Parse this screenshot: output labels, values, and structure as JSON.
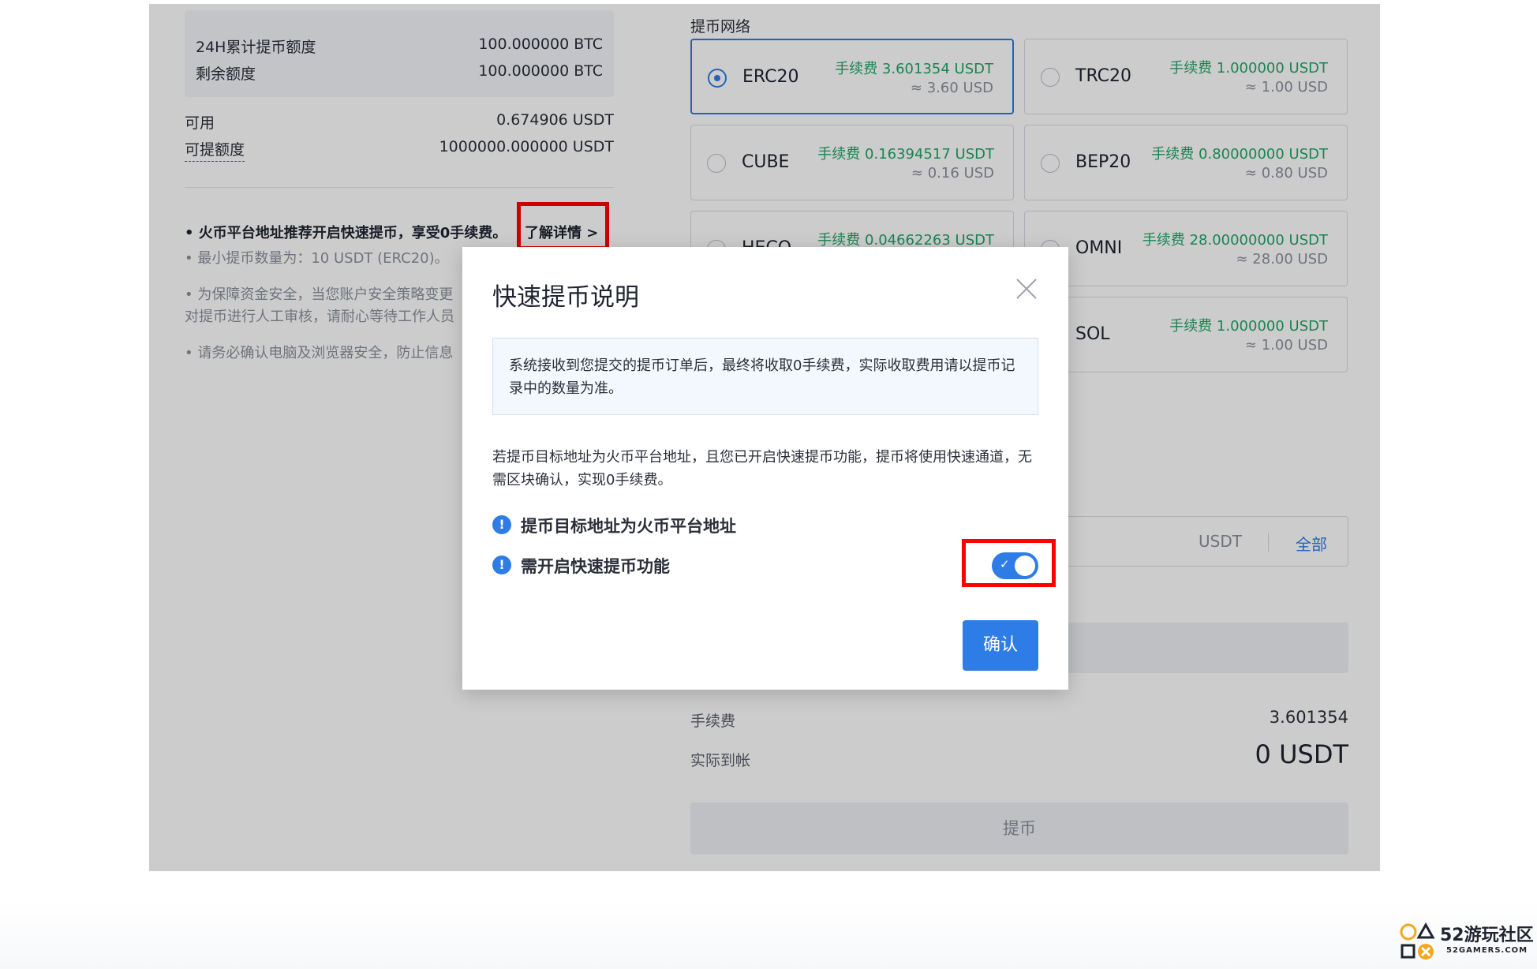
{
  "left": {
    "quota_24h_label": "24H累计提币额度",
    "quota_24h_value": "100.000000 BTC",
    "remaining_label": "剩余额度",
    "remaining_value": "100.000000 BTC",
    "available_label": "可用",
    "available_value": "0.674906 USDT",
    "withdrawable_label": "可提额度",
    "withdrawable_value": "1000000.000000 USDT",
    "notice_fast": "• 火币平台地址推荐开启快速提币，享受0手续费。",
    "learn_more": "了解详情 >",
    "notice_min": "• 最小提币数量为：10 USDT (ERC20)。",
    "notice_security_1": "• 为保障资金安全，当您账户安全策略变更",
    "notice_security_2": "对提币进行人工审核，请耐心等待工作人员",
    "notice_device": "• 请务必确认电脑及浏览器安全，防止信息"
  },
  "networks": {
    "title": "提币网络",
    "items": [
      {
        "name": "ERC20",
        "fee": "手续费 3.601354 USDT",
        "approx": "≈ 3.60 USD",
        "selected": true
      },
      {
        "name": "TRC20",
        "fee": "手续费 1.000000 USDT",
        "approx": "≈ 1.00 USD",
        "selected": false
      },
      {
        "name": "CUBE",
        "fee": "手续费 0.16394517 USDT",
        "approx": "≈ 0.16 USD",
        "selected": false
      },
      {
        "name": "BEP20",
        "fee": "手续费 0.80000000 USDT",
        "approx": "≈ 0.80 USD",
        "selected": false
      },
      {
        "name": "HECO",
        "fee": "手续费 0.04662263 USDT",
        "approx": "",
        "selected": false
      },
      {
        "name": "OMNI",
        "fee": "手续费 28.00000000 USDT",
        "approx": "≈ 28.00 USD",
        "selected": false
      },
      {
        "name": "",
        "fee": "",
        "approx": "",
        "selected": false
      },
      {
        "name": "SOL",
        "fee": "手续费 1.000000 USDT",
        "approx": "≈ 1.00 USD",
        "selected": false
      }
    ]
  },
  "amount": {
    "unit": "USDT",
    "all_label": "全部"
  },
  "summary": {
    "fee_label": "手续费",
    "fee_value": "3.601354",
    "received_label": "实际到帐",
    "received_value": "0 USDT",
    "submit_label": "提币"
  },
  "modal": {
    "title": "快速提币说明",
    "info": "系统接收到您提交的提币订单后，最终将收取0手续费，实际收取费用请以提币记录中的数量为准。",
    "description": "若提币目标地址为火币平台地址，且您已开启快速提币功能，提币将使用快速通道，无需区块确认，实现0手续费。",
    "req_address": "提币目标地址为火币平台地址",
    "req_toggle": "需开启快速提币功能",
    "toggle_on": true,
    "confirm_label": "确认"
  },
  "watermark": {
    "brand": "52游玩社区",
    "domain": "52GAMERS.COM"
  },
  "colors": {
    "accent": "#2e7ce6",
    "fee_green": "#21a564",
    "highlight_red": "#ff0000"
  }
}
